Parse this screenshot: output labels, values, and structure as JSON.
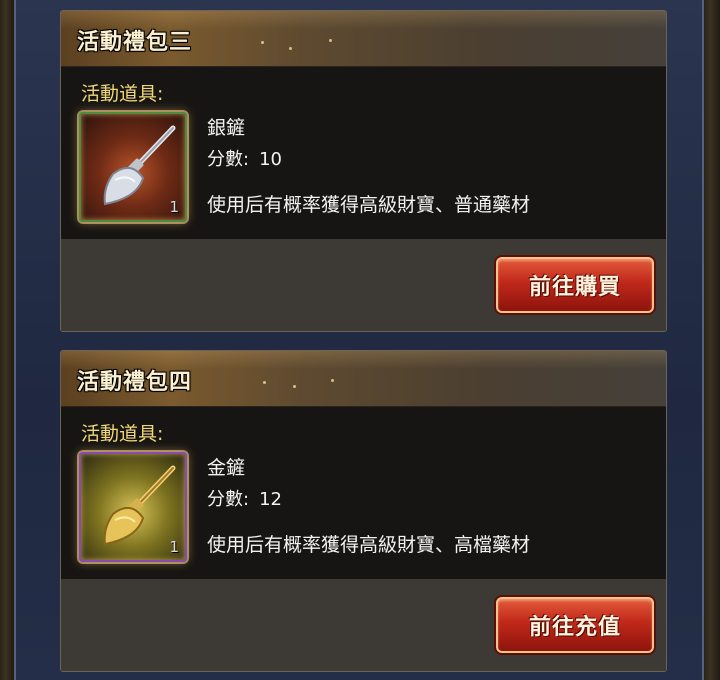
{
  "packs": [
    {
      "title": "活動禮包三",
      "items_label": "活動道具:",
      "item": {
        "icon": "silver-shovel-icon",
        "count": "1",
        "name": "銀鏟",
        "score_label": "分數:",
        "score_value": "10",
        "description": "使用后有概率獲得高級財寶、普通藥材"
      },
      "button_label": "前往購買"
    },
    {
      "title": "活動禮包四",
      "items_label": "活動道具:",
      "item": {
        "icon": "gold-shovel-icon",
        "count": "1",
        "name": "金鏟",
        "score_label": "分數:",
        "score_value": "12",
        "description": "使用后有概率獲得高級財寶、高檔藥材"
      },
      "button_label": "前往充值"
    }
  ],
  "colors": {
    "frame": "#1f2840",
    "panel": "#3d3934",
    "panel_dark": "#171513",
    "label_gold": "#f1d877",
    "button_red": "#c0281a"
  }
}
